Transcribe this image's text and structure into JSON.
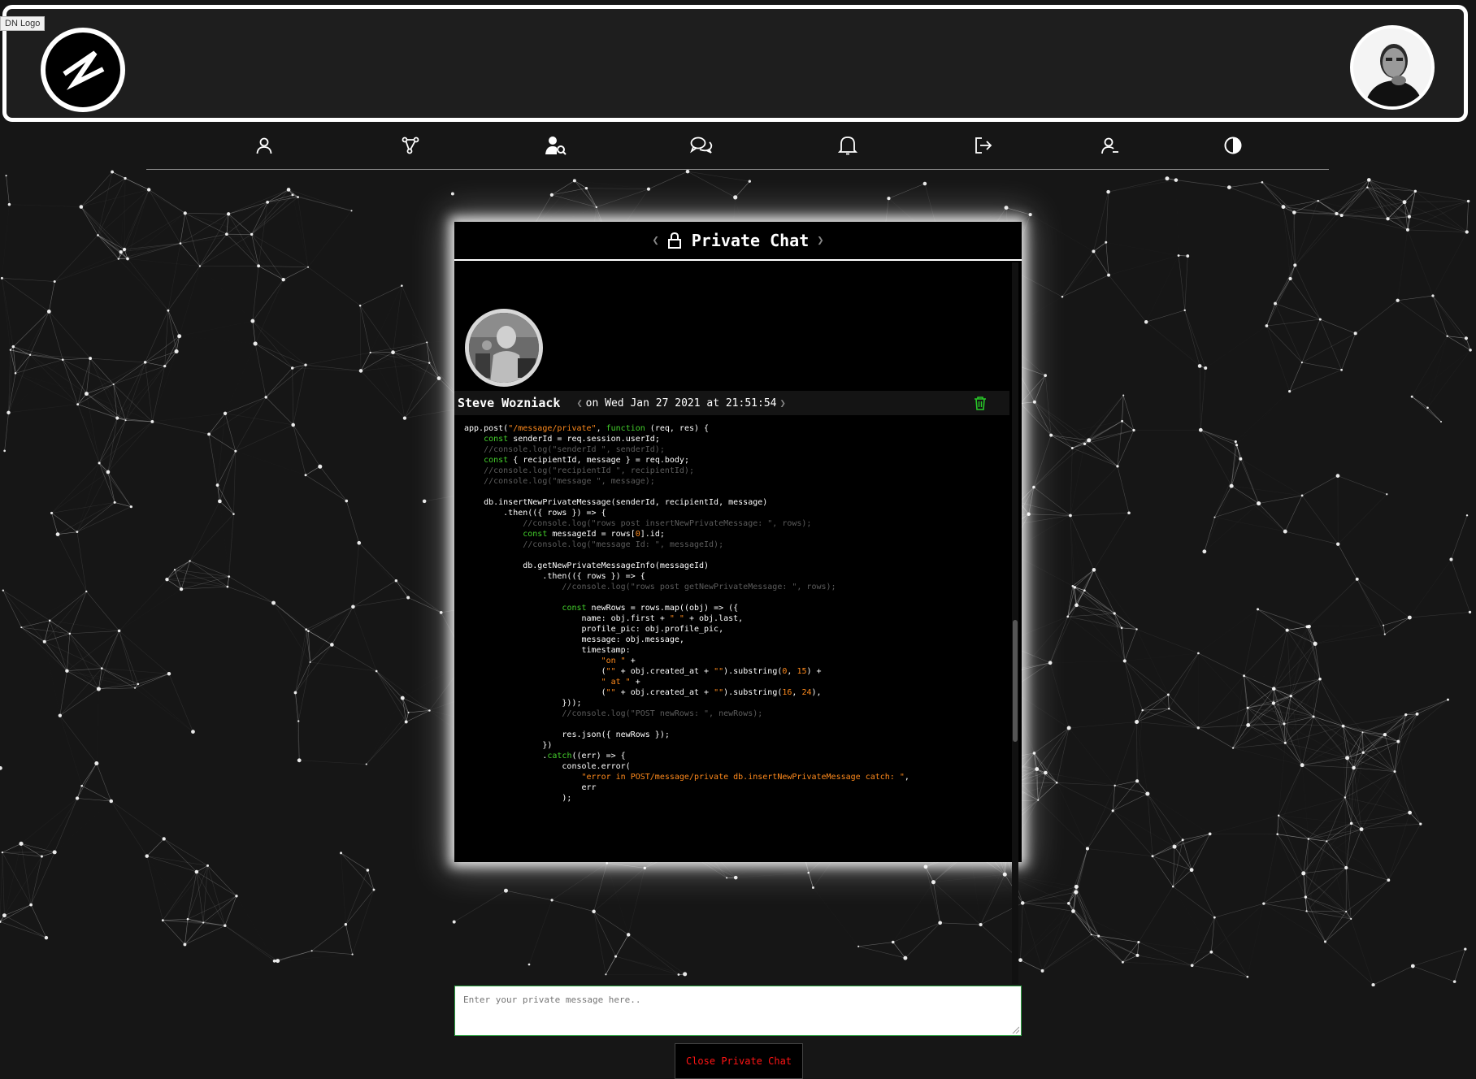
{
  "header": {
    "logo_tooltip": "DN Logo",
    "logo_alt": "DN Logo"
  },
  "nav": {
    "items": [
      {
        "icon": "user-icon",
        "label": "Profile"
      },
      {
        "icon": "network-icon",
        "label": "Network"
      },
      {
        "icon": "find-user-icon",
        "label": "Find People"
      },
      {
        "icon": "chat-icon",
        "label": "Chat"
      },
      {
        "icon": "bell-icon",
        "label": "Notifications"
      },
      {
        "icon": "logout-icon",
        "label": "Logout"
      },
      {
        "icon": "remove-user-icon",
        "label": "Delete Account"
      },
      {
        "icon": "contrast-icon",
        "label": "Theme"
      }
    ]
  },
  "private_chat": {
    "title": "Private Chat",
    "message": {
      "author": "Steve Wozniack",
      "timestamp": "on Wed Jan 27 2021 at 21:51:54",
      "code_lines": [
        [
          [
            "t",
            "app.post("
          ],
          [
            "s",
            "\"/message/private\""
          ],
          [
            "t",
            ", "
          ],
          [
            "k",
            "function"
          ],
          [
            "t",
            " (req, res) {"
          ]
        ],
        [
          [
            "t",
            "    "
          ],
          [
            "k",
            "const"
          ],
          [
            "t",
            " senderId = req.session.userId;"
          ]
        ],
        [
          [
            "c",
            "    //console.log(\"senderId \", senderId);"
          ]
        ],
        [
          [
            "t",
            "    "
          ],
          [
            "k",
            "const"
          ],
          [
            "t",
            " { recipientId, message } = req.body;"
          ]
        ],
        [
          [
            "c",
            "    //console.log(\"recipientId \", recipientId);"
          ]
        ],
        [
          [
            "c",
            "    //console.log(\"message \", message);"
          ]
        ],
        [
          [
            "t",
            ""
          ]
        ],
        [
          [
            "t",
            "    db.insertNewPrivateMessage(senderId, recipientId, message)"
          ]
        ],
        [
          [
            "t",
            "        .then(({ rows }) => {"
          ]
        ],
        [
          [
            "c",
            "            //console.log(\"rows post insertNewPrivateMessage: \", rows);"
          ]
        ],
        [
          [
            "t",
            "            "
          ],
          [
            "k",
            "const"
          ],
          [
            "t",
            " messageId = rows["
          ],
          [
            "s",
            "0"
          ],
          [
            "t",
            "].id;"
          ]
        ],
        [
          [
            "c",
            "            //console.log(\"message Id: \", messageId);"
          ]
        ],
        [
          [
            "t",
            ""
          ]
        ],
        [
          [
            "t",
            "            db.getNewPrivateMessageInfo(messageId)"
          ]
        ],
        [
          [
            "t",
            "                .then(({ rows }) => {"
          ]
        ],
        [
          [
            "c",
            "                    //console.log(\"rows post getNewPrivateMessage: \", rows);"
          ]
        ],
        [
          [
            "t",
            ""
          ]
        ],
        [
          [
            "t",
            "                    "
          ],
          [
            "k",
            "const"
          ],
          [
            "t",
            " newRows = rows.map((obj) => ({"
          ]
        ],
        [
          [
            "t",
            "                        name: obj.first + "
          ],
          [
            "s",
            "\" \""
          ],
          [
            "t",
            " + obj.last,"
          ]
        ],
        [
          [
            "t",
            "                        profile_pic: obj.profile_pic,"
          ]
        ],
        [
          [
            "t",
            "                        message: obj.message,"
          ]
        ],
        [
          [
            "t",
            "                        timestamp:"
          ]
        ],
        [
          [
            "t",
            "                            "
          ],
          [
            "s",
            "\"on \""
          ],
          [
            "t",
            " +"
          ]
        ],
        [
          [
            "t",
            "                            ("
          ],
          [
            "s",
            "\"\""
          ],
          [
            "t",
            " + obj.created_at + "
          ],
          [
            "s",
            "\"\""
          ],
          [
            "t",
            ").substring("
          ],
          [
            "s",
            "0"
          ],
          [
            "t",
            ", "
          ],
          [
            "s",
            "15"
          ],
          [
            "t",
            ") +"
          ]
        ],
        [
          [
            "t",
            "                            "
          ],
          [
            "s",
            "\" at \""
          ],
          [
            "t",
            " +"
          ]
        ],
        [
          [
            "t",
            "                            ("
          ],
          [
            "s",
            "\"\""
          ],
          [
            "t",
            " + obj.created_at + "
          ],
          [
            "s",
            "\"\""
          ],
          [
            "t",
            ").substring("
          ],
          [
            "s",
            "16"
          ],
          [
            "t",
            ", "
          ],
          [
            "s",
            "24"
          ],
          [
            "t",
            "),"
          ]
        ],
        [
          [
            "t",
            "                    }));"
          ]
        ],
        [
          [
            "c",
            "                    //console.log(\"POST newRows: \", newRows);"
          ]
        ],
        [
          [
            "t",
            ""
          ]
        ],
        [
          [
            "t",
            "                    res.json({ newRows });"
          ]
        ],
        [
          [
            "t",
            "                })"
          ]
        ],
        [
          [
            "t",
            "                ."
          ],
          [
            "k",
            "catch"
          ],
          [
            "t",
            "((err) => {"
          ]
        ],
        [
          [
            "t",
            "                    console.error("
          ]
        ],
        [
          [
            "t",
            "                        "
          ],
          [
            "s",
            "\"error in POST/message/private db.insertNewPrivateMessage catch: \""
          ],
          [
            "t",
            ","
          ]
        ],
        [
          [
            "t",
            "                        err"
          ]
        ],
        [
          [
            "t",
            "                    );"
          ]
        ]
      ]
    },
    "input_placeholder": "Enter your private message here..",
    "close_button": "Close Private Chat"
  },
  "colors": {
    "keyword": "#44d02c",
    "string": "#ff8a1c",
    "comment": "#5c5c5c",
    "trash": "#28c828",
    "close_text": "#ff1414"
  }
}
